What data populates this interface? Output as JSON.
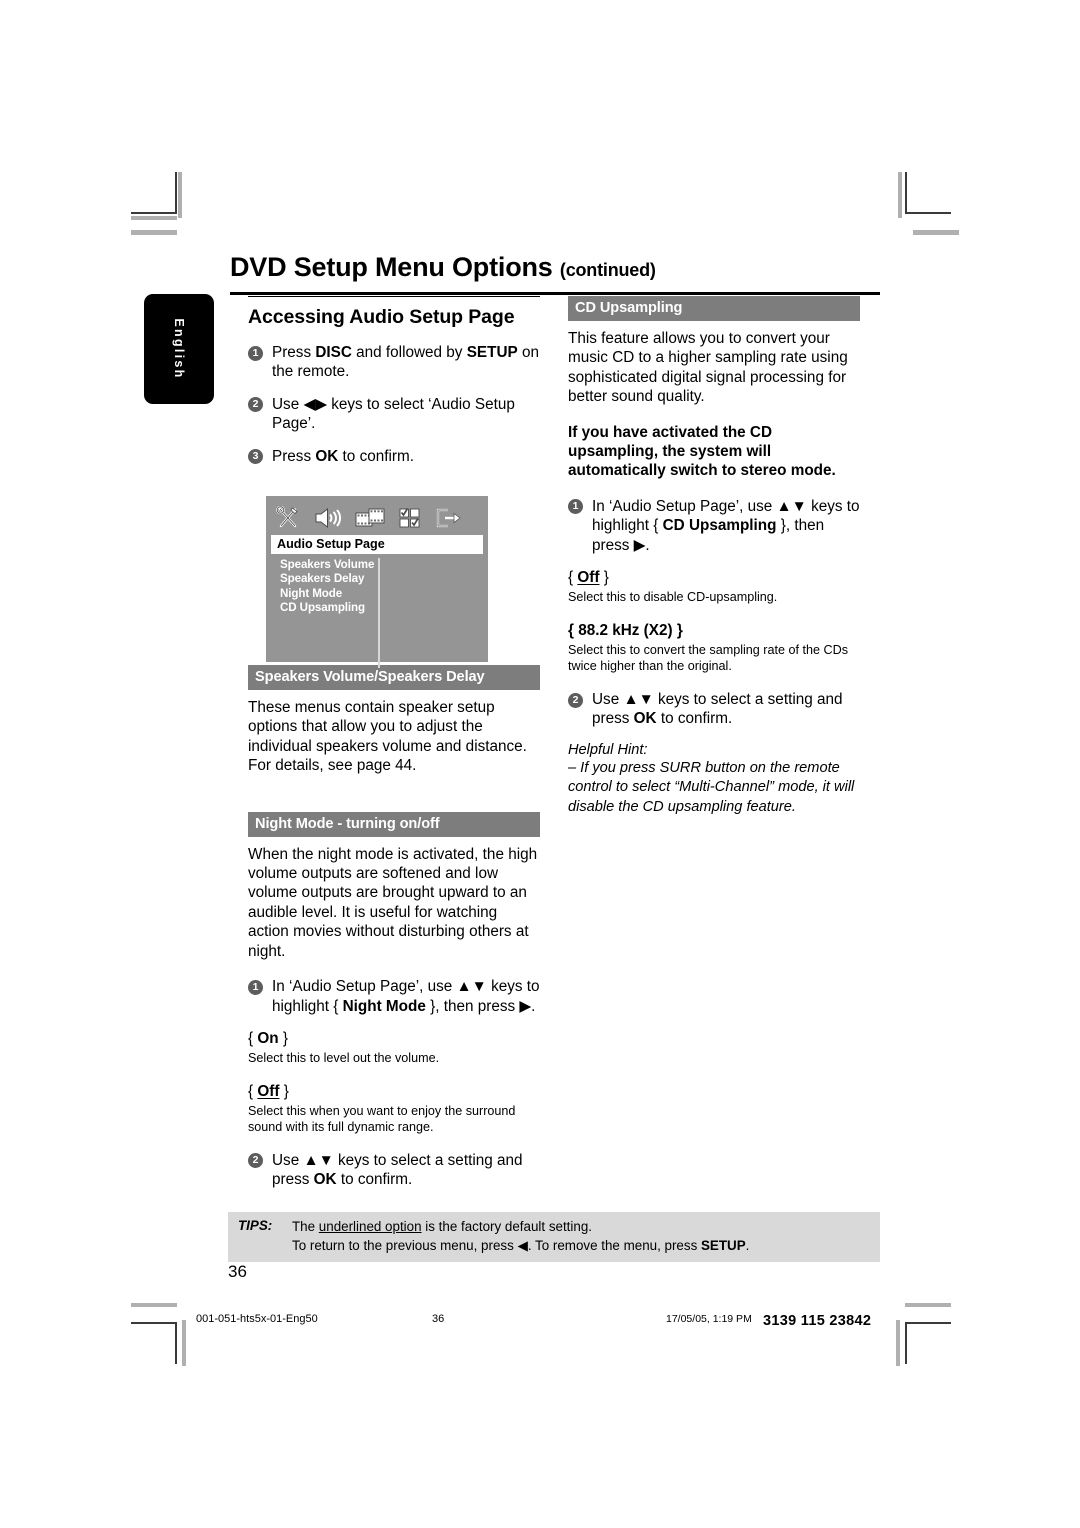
{
  "header": {
    "title": "DVD Setup Menu Options",
    "title_suffix": "(continued)",
    "language_tab": "English"
  },
  "left_column": {
    "section_heading": "Accessing Audio Setup Page",
    "steps": [
      {
        "num": "1",
        "html": "Press <b>DISC</b> and followed by <b>SETUP</b> on the remote."
      },
      {
        "num": "2",
        "html": "Use ◀▶ keys to select ‘Audio Setup Page’."
      },
      {
        "num": "3",
        "html": "Press <b>OK</b> to confirm."
      }
    ],
    "tv_menu": {
      "icons": [
        "tools-icon",
        "speaker-icon",
        "film-icon",
        "preference-icon",
        "exit-icon"
      ],
      "page_title": "Audio Setup Page",
      "items": [
        "Speakers Volume",
        "Speakers Delay",
        "Night Mode",
        "CD Upsampling"
      ]
    },
    "speakers_section": {
      "bar_title": "Speakers Volume/Speakers Delay",
      "body": "These menus contain speaker setup options that allow you to adjust the individual speakers volume and distance. For details, see page 44."
    },
    "night_mode_section": {
      "bar_title": "Night Mode - turning on/off",
      "body": "When the night mode is activated, the high volume outputs are softened and low volume outputs are brought upward to an audible level.  It is useful for watching action movies without disturbing others at night.",
      "step1": {
        "num": "1",
        "html": "In ‘Audio Setup Page’, use ▲▼ keys to highlight { <b>Night Mode</b> }, then press ▶."
      },
      "option_on_label": "{ On }",
      "option_on_desc": "Select this to level out the volume.",
      "option_off_label": "{ Off }",
      "option_off_desc": "Select this when you want to enjoy the surround sound with its full dynamic range.",
      "step2": {
        "num": "2",
        "html": "Use ▲▼ keys to select a setting and press <b>OK</b> to confirm."
      }
    }
  },
  "right_column": {
    "bar_title": "CD Upsampling",
    "intro": "This feature allows you to convert your music CD to a higher sampling rate using sophisticated digital signal processing for better sound quality.",
    "bold_note": "If you have activated the CD upsampling, the system will automatically switch to stereo mode.",
    "step1": {
      "num": "1",
      "html": "In ‘Audio Setup Page’, use ▲▼ keys to highlight { <b>CD Upsampling</b> }, then press ▶."
    },
    "option_off_label": "{ Off }",
    "option_off_desc": "Select this to disable CD-upsampling.",
    "option_882_label": "{ 88.2 kHz (X2) }",
    "option_882_desc": "Select this to convert the sampling rate of the CDs twice higher than the original.",
    "step2": {
      "num": "2",
      "html": "Use ▲▼ keys to select a setting and press <b>OK</b> to confirm."
    },
    "hint_title": "Helpful Hint:",
    "hint_body": "–  If you press SURR button on the remote control to select “Multi-Channel” mode, it will disable the CD upsampling feature."
  },
  "tips": {
    "label": "TIPS:",
    "line1_html": "The <u>underlined option</u> is the factory default setting.",
    "line2_html": "To return to the previous menu, press ◀.  To remove the menu, press <b>SETUP</b>."
  },
  "folio": "36",
  "printer_footer": {
    "file": "001-051-hts5x-01-Eng50",
    "page": "36",
    "date": "17/05/05, 1:19 PM",
    "code": "3139 115 23842"
  },
  "colors": {
    "bar_gray": "#7d7d7d",
    "tips_gray": "#d9d9d9",
    "tv_gray": "#959595",
    "bullet_gray": "#5d5d5d"
  }
}
